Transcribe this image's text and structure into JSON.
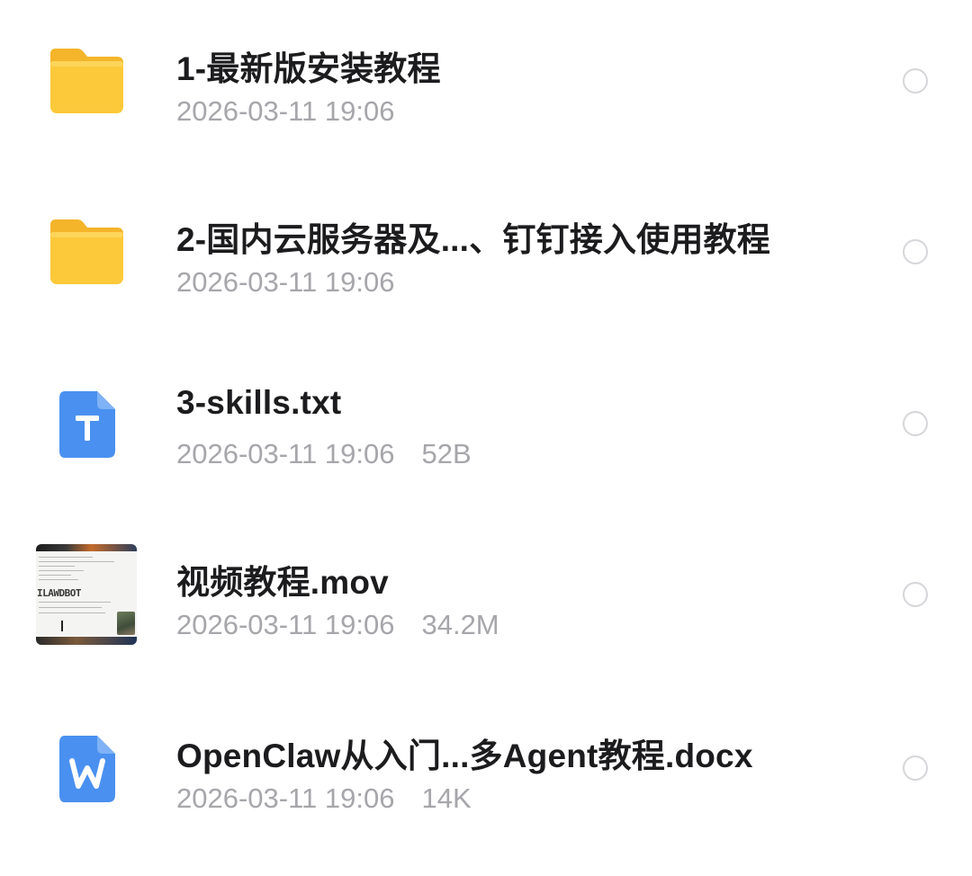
{
  "files": [
    {
      "name": "1-最新版安装教程",
      "date": "2026-03-11 19:06",
      "size": "",
      "icon": "folder-icon"
    },
    {
      "name": "2-国内云服务器及...、钉钉接入使用教程",
      "date": "2026-03-11 19:06",
      "size": "",
      "icon": "folder-icon"
    },
    {
      "name": "3-skills.txt",
      "date": "2026-03-11 19:06",
      "size": "52B",
      "icon": "txt-file-icon"
    },
    {
      "name": "视频教程.mov",
      "date": "2026-03-11 19:06",
      "size": "34.2M",
      "icon": "video-thumbnail"
    },
    {
      "name": "OpenClaw从入门...多Agent教程.docx",
      "date": "2026-03-11 19:06",
      "size": "14K",
      "icon": "word-file-icon"
    }
  ],
  "video_thumbnail": {
    "logo_text": "ILAWDBOT"
  },
  "colors": {
    "folder": "#FCC93A",
    "txt_icon": "#4A90F0",
    "word_icon": "#4A90F0",
    "name_text": "#1C1C1E",
    "meta_text": "#A6A6AB",
    "select_circle": "#D6D6DA"
  }
}
